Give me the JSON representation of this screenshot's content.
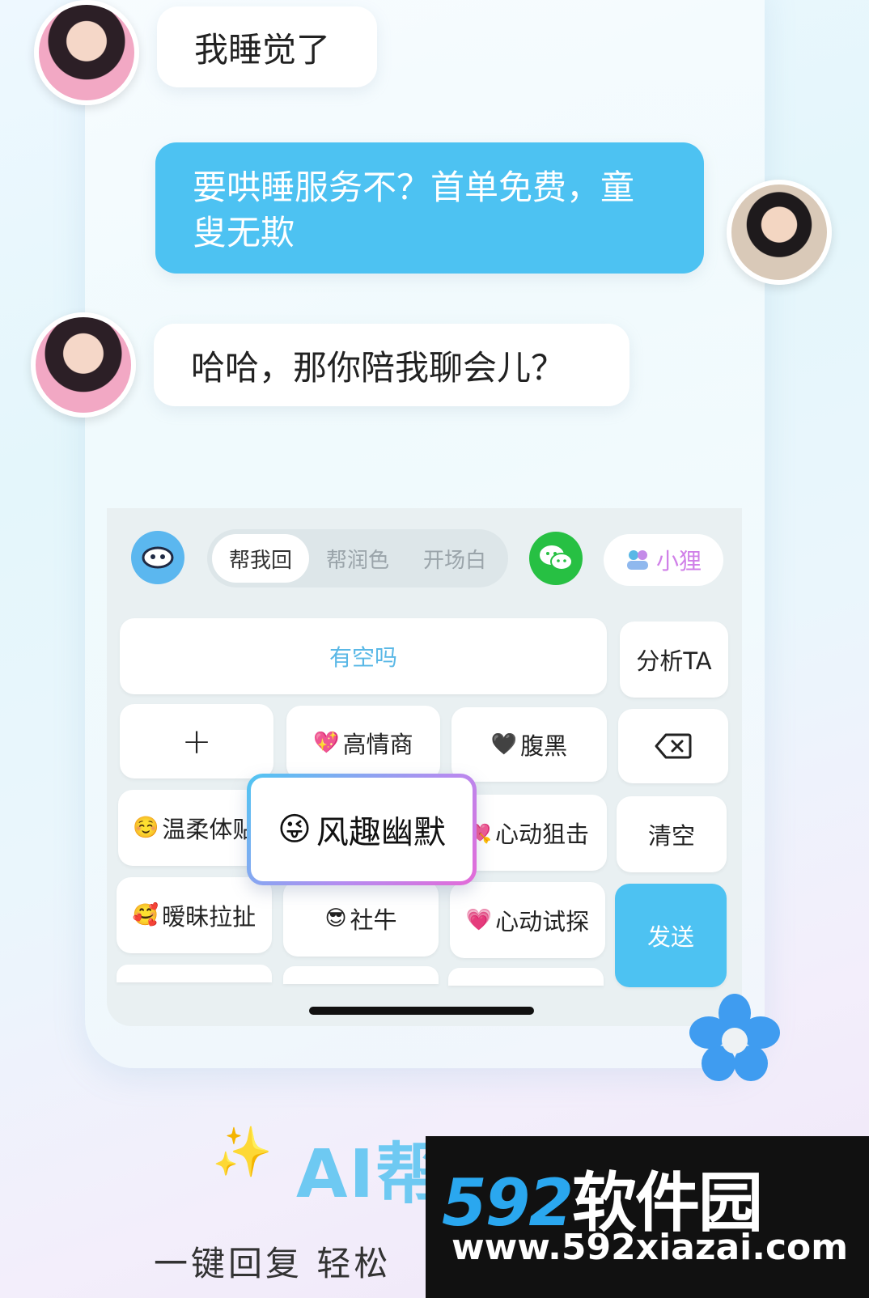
{
  "chat": {
    "msg1": "我睡觉了",
    "msg2": "要哄睡服务不？首单免费，童叟无欺",
    "msg3": "哈哈，那你陪我聊会儿？"
  },
  "toolbar": {
    "tabs": [
      "帮我回",
      "帮润色",
      "开场白"
    ],
    "contact_label": "小狸"
  },
  "keyboard": {
    "input_text": "有空吗",
    "analyze": "分析TA",
    "plus": "+",
    "clear": "清空",
    "send": "发送",
    "styles": [
      {
        "emoji": "💖",
        "label": "高情商"
      },
      {
        "emoji": "🖤",
        "label": "腹黑"
      },
      {
        "emoji": "☺️",
        "label": "温柔体贴"
      },
      {
        "emoji": "💘",
        "label": "心动狙击"
      },
      {
        "emoji": "🥰",
        "label": "暧昧拉扯"
      },
      {
        "emoji": "😎",
        "label": "社牛"
      },
      {
        "emoji": "💗",
        "label": "心动试探"
      }
    ],
    "popup": {
      "emoji": "😜",
      "label": "风趣幽默"
    }
  },
  "promo": {
    "title": "AI帮你",
    "tagline": "一键回复 轻松"
  },
  "watermark": {
    "logo_num": "592",
    "logo_cn": "软件园",
    "url": "www.592xiazai.com"
  }
}
